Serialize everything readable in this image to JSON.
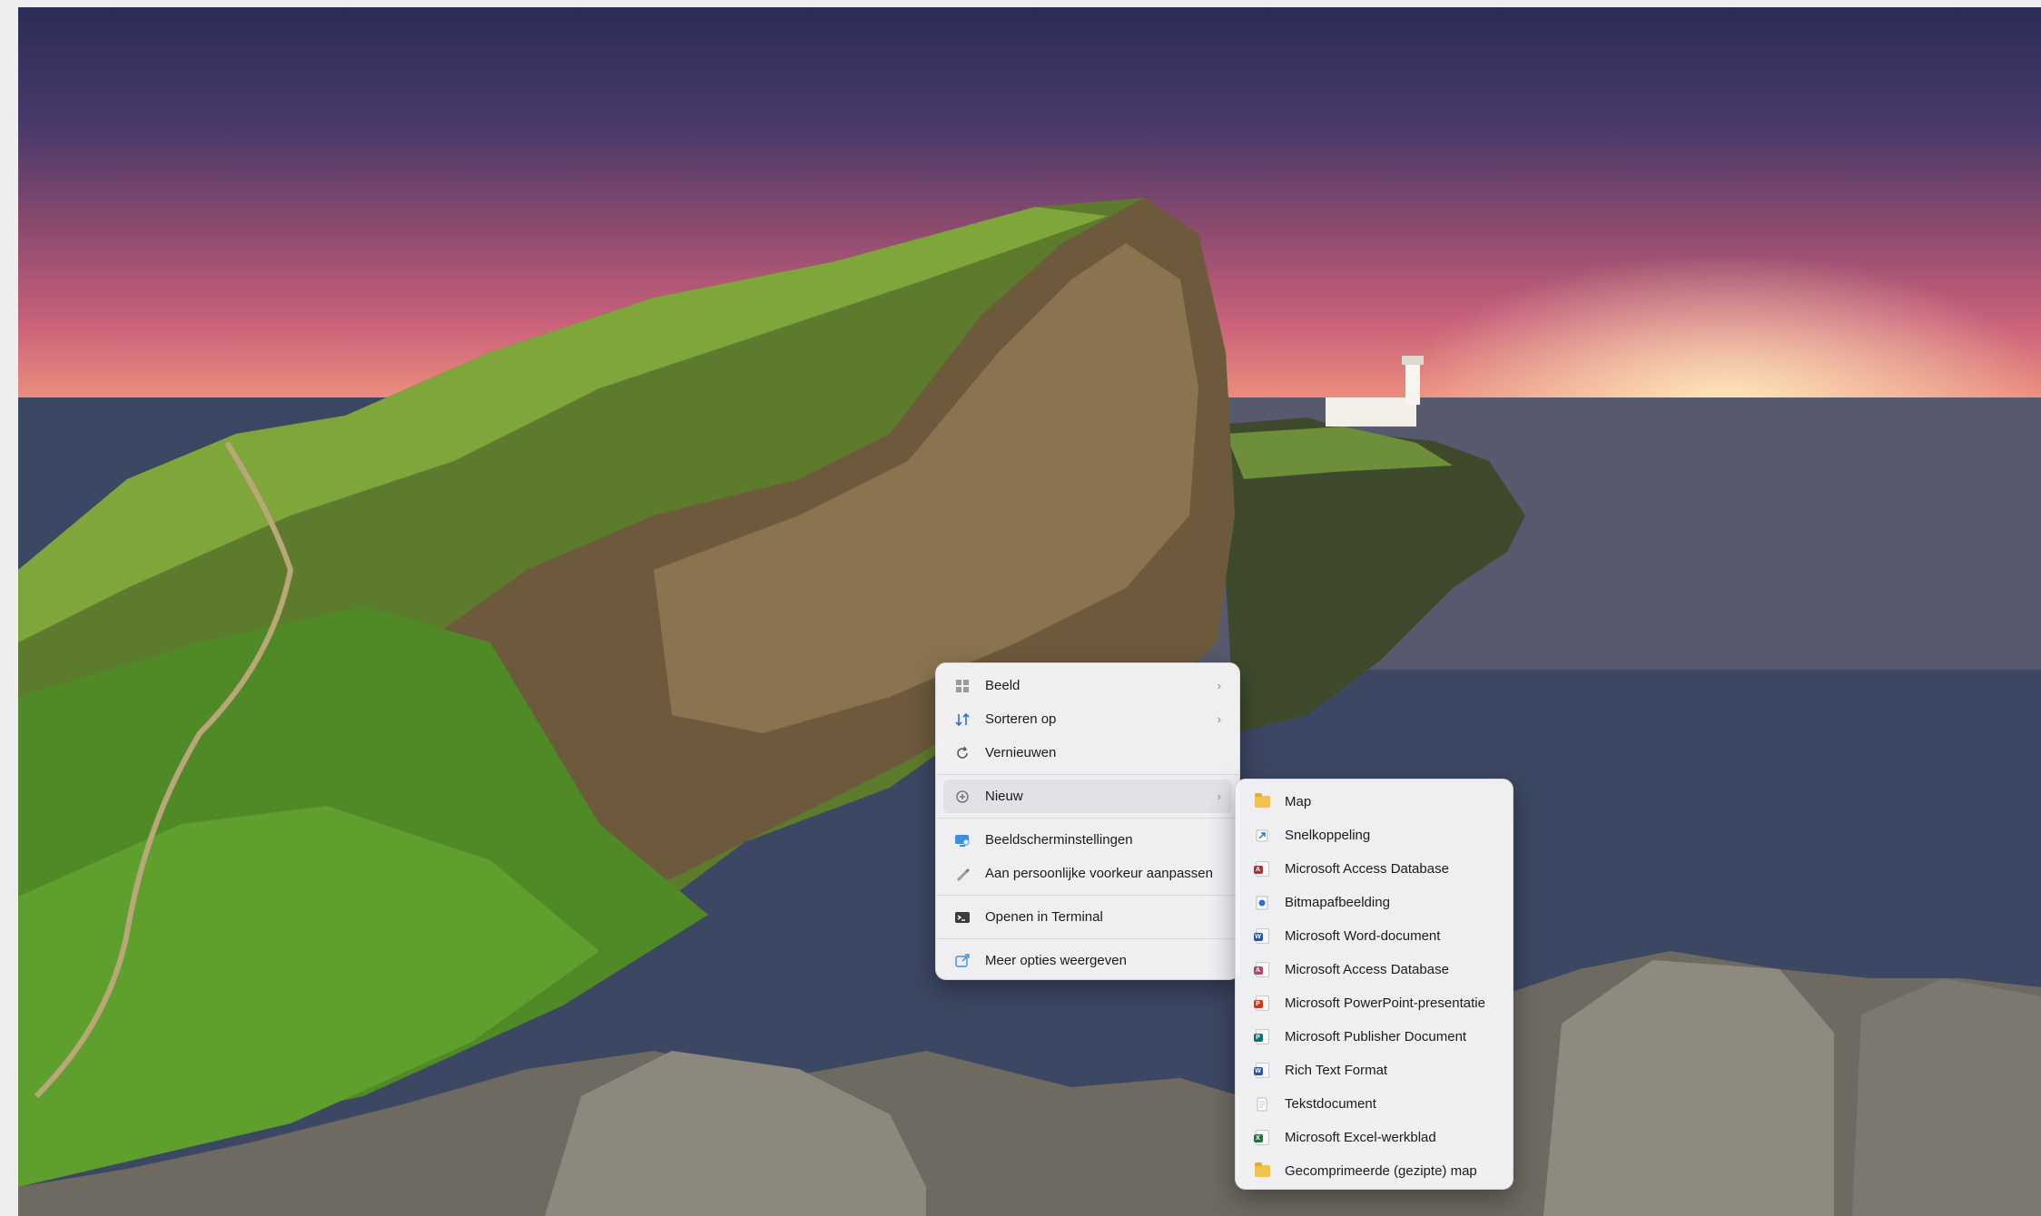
{
  "colors": {
    "menu_background": "#f5f5f7",
    "menu_text": "#1b1b1b",
    "hover_background": "#e2e2e6",
    "folder_yellow": "#f2c14e",
    "access_red": "#a4373a",
    "word_blue": "#2b579a",
    "powerpoint_orange": "#c43e1c",
    "publisher_teal": "#077568",
    "excel_green": "#217346"
  },
  "context_menu": {
    "items": [
      {
        "label": "Beeld",
        "icon": "grid-icon",
        "has_submenu": true
      },
      {
        "label": "Sorteren op",
        "icon": "sort-icon",
        "has_submenu": true
      },
      {
        "label": "Vernieuwen",
        "icon": "refresh-icon",
        "has_submenu": false
      },
      {
        "label": "Nieuw",
        "icon": "new-plus-icon",
        "has_submenu": true,
        "active": true
      },
      {
        "label": "Beeldscherminstellingen",
        "icon": "display-settings-icon",
        "has_submenu": false
      },
      {
        "label": "Aan persoonlijke voorkeur aanpassen",
        "icon": "brush-icon",
        "has_submenu": false
      },
      {
        "label": "Openen in Terminal",
        "icon": "terminal-icon",
        "has_submenu": false
      },
      {
        "label": "Meer opties weergeven",
        "icon": "share-more-icon",
        "has_submenu": false
      }
    ],
    "submenu_chevron": "›"
  },
  "new_submenu": {
    "items": [
      {
        "label": "Map",
        "icon": "folder-icon"
      },
      {
        "label": "Snelkoppeling",
        "icon": "shortcut-icon"
      },
      {
        "label": "Microsoft Access Database",
        "icon": "access-icon",
        "tag": "A"
      },
      {
        "label": "Bitmapafbeelding",
        "icon": "bitmap-icon"
      },
      {
        "label": "Microsoft Word-document",
        "icon": "word-icon",
        "tag": "W"
      },
      {
        "label": "Microsoft Access Database",
        "icon": "access-icon",
        "tag": "A"
      },
      {
        "label": "Microsoft PowerPoint-presentatie",
        "icon": "powerpoint-icon",
        "tag": "P"
      },
      {
        "label": "Microsoft Publisher Document",
        "icon": "publisher-icon",
        "tag": "P"
      },
      {
        "label": "Rich Text Format",
        "icon": "rtf-icon",
        "tag": "W"
      },
      {
        "label": "Tekstdocument",
        "icon": "text-document-icon"
      },
      {
        "label": "Microsoft Excel-werkblad",
        "icon": "excel-icon",
        "tag": "X"
      },
      {
        "label": "Gecomprimeerde (gezipte) map",
        "icon": "zip-folder-icon"
      }
    ]
  }
}
